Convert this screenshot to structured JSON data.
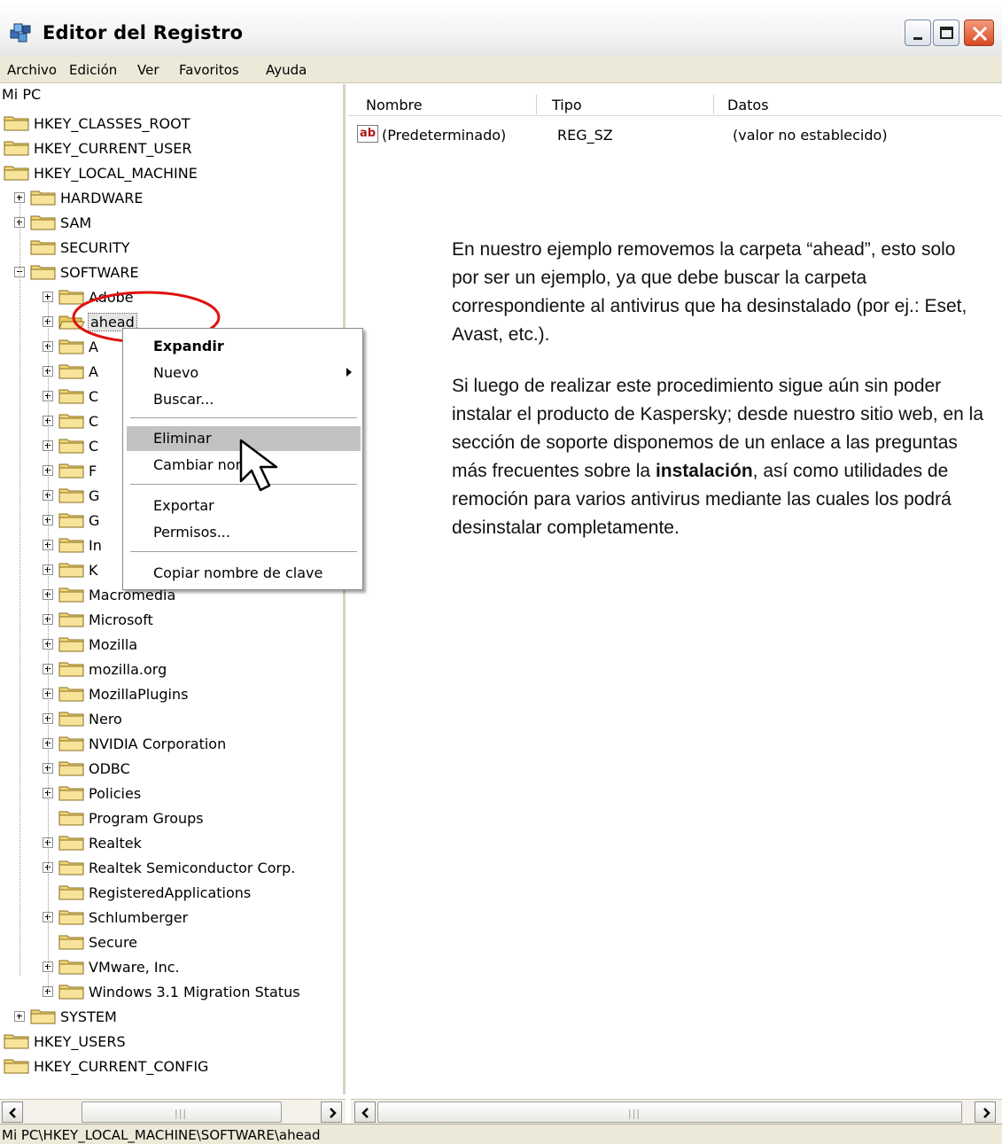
{
  "window": {
    "title": "Editor del Registro"
  },
  "menu": [
    "Archivo",
    "Edición",
    "Ver",
    "Favoritos",
    "Ayuda"
  ],
  "tree": {
    "root": "Mi PC",
    "hives_top": [
      "HKEY_CLASSES_ROOT",
      "HKEY_CURRENT_USER",
      "HKEY_LOCAL_MACHINE"
    ],
    "hklm_children": [
      "HARDWARE",
      "SAM",
      "SECURITY",
      "SOFTWARE"
    ],
    "software_children": [
      "Adobe",
      "ahead",
      "A",
      "A",
      "C",
      "C",
      "C",
      "F",
      "G",
      "G",
      "In",
      "K",
      "Macromedia",
      "Microsoft",
      "Mozilla",
      "mozilla.org",
      "MozillaPlugins",
      "Nero",
      "NVIDIA Corporation",
      "ODBC",
      "Policies",
      "Program Groups",
      "Realtek",
      "Realtek Semiconductor Corp.",
      "RegisteredApplications",
      "Schlumberger",
      "Secure",
      "VMware, Inc.",
      "Windows 3.1 Migration Status"
    ],
    "after_software": "SYSTEM",
    "hives_bottom": [
      "HKEY_USERS",
      "HKEY_CURRENT_CONFIG"
    ],
    "selected": "ahead"
  },
  "list": {
    "columns": [
      "Nombre",
      "Tipo",
      "Datos"
    ],
    "rows": [
      {
        "icon": "ab",
        "name": "(Predeterminado)",
        "type": "REG_SZ",
        "data": "(valor no establecido)"
      }
    ]
  },
  "context_menu": {
    "items": [
      "Expandir",
      "Nuevo",
      "Buscar...",
      "Eliminar",
      "Cambiar nom",
      "Exportar",
      "Permisos...",
      "Copiar nombre de clave"
    ],
    "highlighted": "Eliminar"
  },
  "article": {
    "p1": "En nuestro ejemplo removemos la carpeta “ahead”, esto solo por ser un ejemplo, ya que debe buscar la carpeta correspondiente al antivirus que ha desinstalado (por ej.: Eset, Avast, etc.).",
    "p2_before": "Si luego de realizar este procedimiento sigue aún sin poder instalar el producto de Kaspersky; desde nuestro sitio web, en la sección de soporte disponemos de un enlace a las preguntas más frecuentes sobre la ",
    "p2_bold": "instalación",
    "p2_after": ", así como utilidades de remoción para varios antivirus mediante las cuales los podrá desinstalar completamente."
  },
  "status": "Mi PC\\HKEY_LOCAL_MACHINE\\SOFTWARE\\ahead",
  "colors": {
    "highlight_ellipse": "#e01010",
    "menu_bg": "#ece9d8",
    "close_button": "#d84a22"
  }
}
